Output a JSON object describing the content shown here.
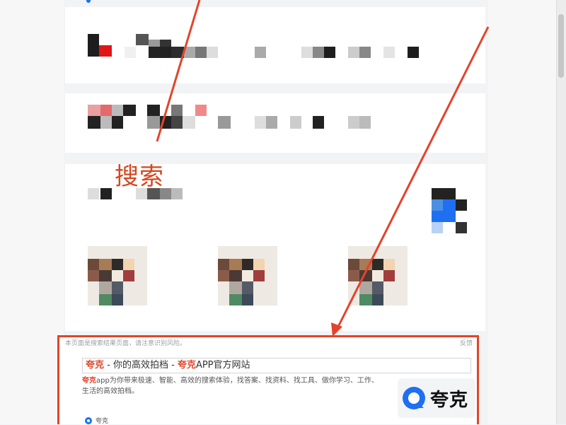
{
  "annotation": {
    "label": "搜索",
    "color": "#d6461f"
  },
  "result": {
    "note": "本页面是搜索结果页面，请注意识别风险。",
    "feedback": "反馈",
    "title_parts": [
      {
        "text": "夸克",
        "highlight": true
      },
      {
        "text": " - 你的高效拍档 - ",
        "highlight": false
      },
      {
        "text": "夸克",
        "highlight": true
      },
      {
        "text": "APP官方网站",
        "highlight": false
      }
    ],
    "description_highlight": "夸克",
    "description": "app为你带来极速、智能、高效的搜索体验，找答案、找资料、找工具、做你学习、工作、生活的高效拍档。",
    "source_name": "夸克",
    "logo_text": "夸克",
    "highlight_color": "#e2442a",
    "border_color": "#e2442a"
  },
  "colors": {
    "accent_blue": "#1a73e8",
    "brand_blue": "#1f6ff2"
  },
  "icons": {
    "logo": "quark-logo-icon",
    "source": "quark-source-icon"
  }
}
